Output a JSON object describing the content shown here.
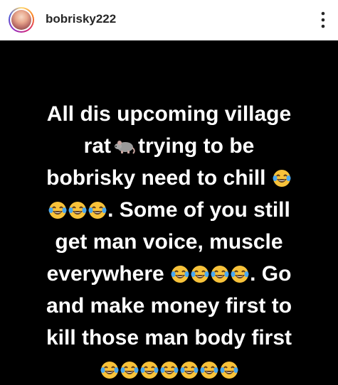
{
  "header": {
    "username": "bobrisky222",
    "avatar_icon": "profile-avatar",
    "menu_icon": "more-vertical-icon"
  },
  "post": {
    "background": "#000000",
    "text_color": "#ffffff",
    "lines": [
      "All dis upcoming village",
      "rat",
      "trying to be",
      "bobrisky need to chill",
      ". Some of you still",
      "get man voice, muscle",
      "everywhere",
      ". Go",
      "and make money first to",
      "kill those man body first"
    ],
    "emoji_icon": "face-with-tears-of-joy",
    "rat_icon": "rat-emoji"
  }
}
